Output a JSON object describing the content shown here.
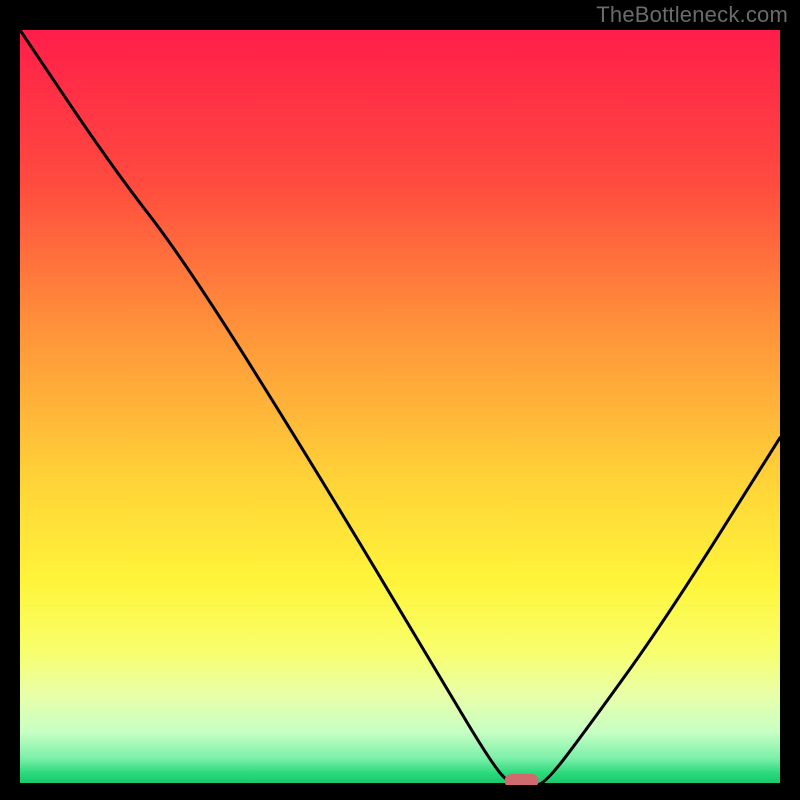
{
  "watermark": "TheBottleneck.com",
  "chart_data": {
    "type": "line",
    "title": "",
    "xlabel": "",
    "ylabel": "",
    "xlim": [
      0,
      100
    ],
    "ylim": [
      0,
      100
    ],
    "series": [
      {
        "name": "curve",
        "x": [
          0,
          12,
          22,
          40,
          56,
          62,
          64.5,
          67,
          69,
          75,
          85,
          100
        ],
        "values": [
          100,
          82,
          69,
          40,
          13,
          3,
          0,
          0,
          0,
          8,
          22,
          46
        ]
      }
    ],
    "marker": {
      "x": 66,
      "y": 0,
      "color": "#cf6b6e"
    },
    "gradient_stops": [
      {
        "offset": 0.0,
        "color": "#ff1e4a"
      },
      {
        "offset": 0.2,
        "color": "#ff4a3f"
      },
      {
        "offset": 0.4,
        "color": "#ff943a"
      },
      {
        "offset": 0.6,
        "color": "#ffd438"
      },
      {
        "offset": 0.73,
        "color": "#fff43a"
      },
      {
        "offset": 0.82,
        "color": "#f8ff6a"
      },
      {
        "offset": 0.88,
        "color": "#e9ffa8"
      },
      {
        "offset": 0.93,
        "color": "#c7ffc4"
      },
      {
        "offset": 0.965,
        "color": "#7af0a8"
      },
      {
        "offset": 0.985,
        "color": "#28d87a"
      },
      {
        "offset": 1.0,
        "color": "#18c76a"
      }
    ]
  }
}
